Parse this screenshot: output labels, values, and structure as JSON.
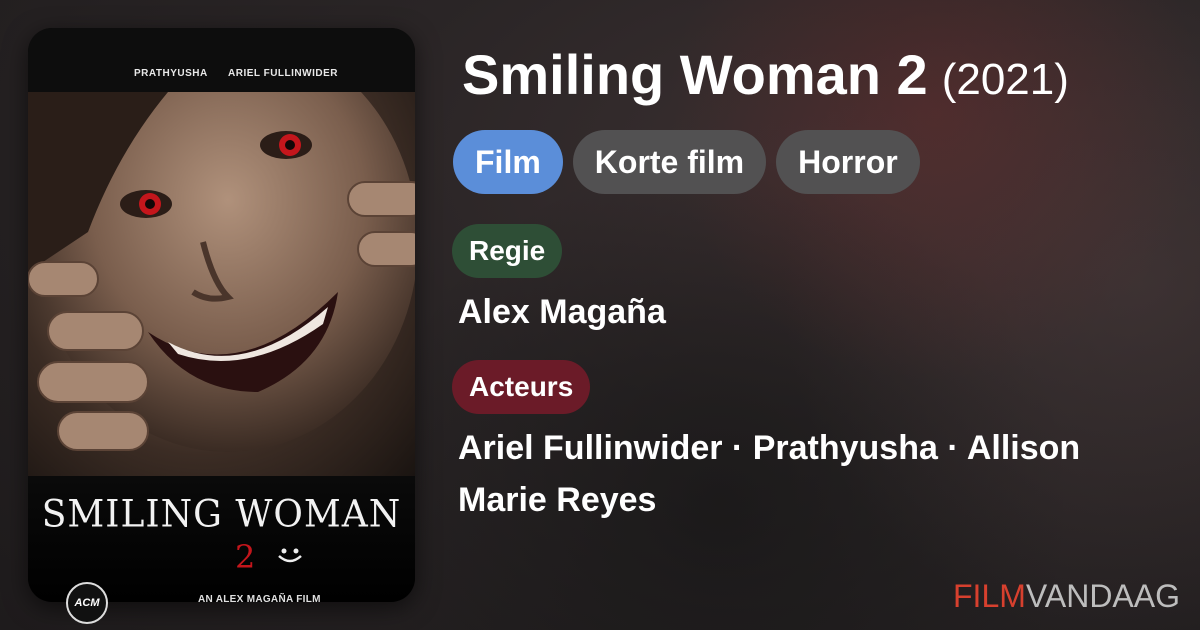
{
  "poster": {
    "credit_left": "PRATHYUSHA",
    "credit_right": "ARIEL FULLINWIDER",
    "title": "SMILING WOMAN",
    "number": "2",
    "studio_logo": "ACM",
    "byline": "AN ALEX MAGAÑA FILM"
  },
  "movie": {
    "title": "Smiling Woman 2",
    "year": "(2021)"
  },
  "genres": [
    "Film",
    "Korte film",
    "Horror"
  ],
  "director_label": "Regie",
  "director": "Alex Magaña",
  "cast_label": "Acteurs",
  "cast": "Ariel Fullinwider · Prathyusha · Allison Marie Reyes",
  "brand": {
    "part1": "FILM",
    "part2": "VANDAAG"
  },
  "colors": {
    "film_chip": "#5b8ed9",
    "genre_chip": "#525152",
    "regie_pill": "#2e4e36",
    "acteurs_pill": "#6b1b28",
    "brand_accent": "#d7402e"
  }
}
